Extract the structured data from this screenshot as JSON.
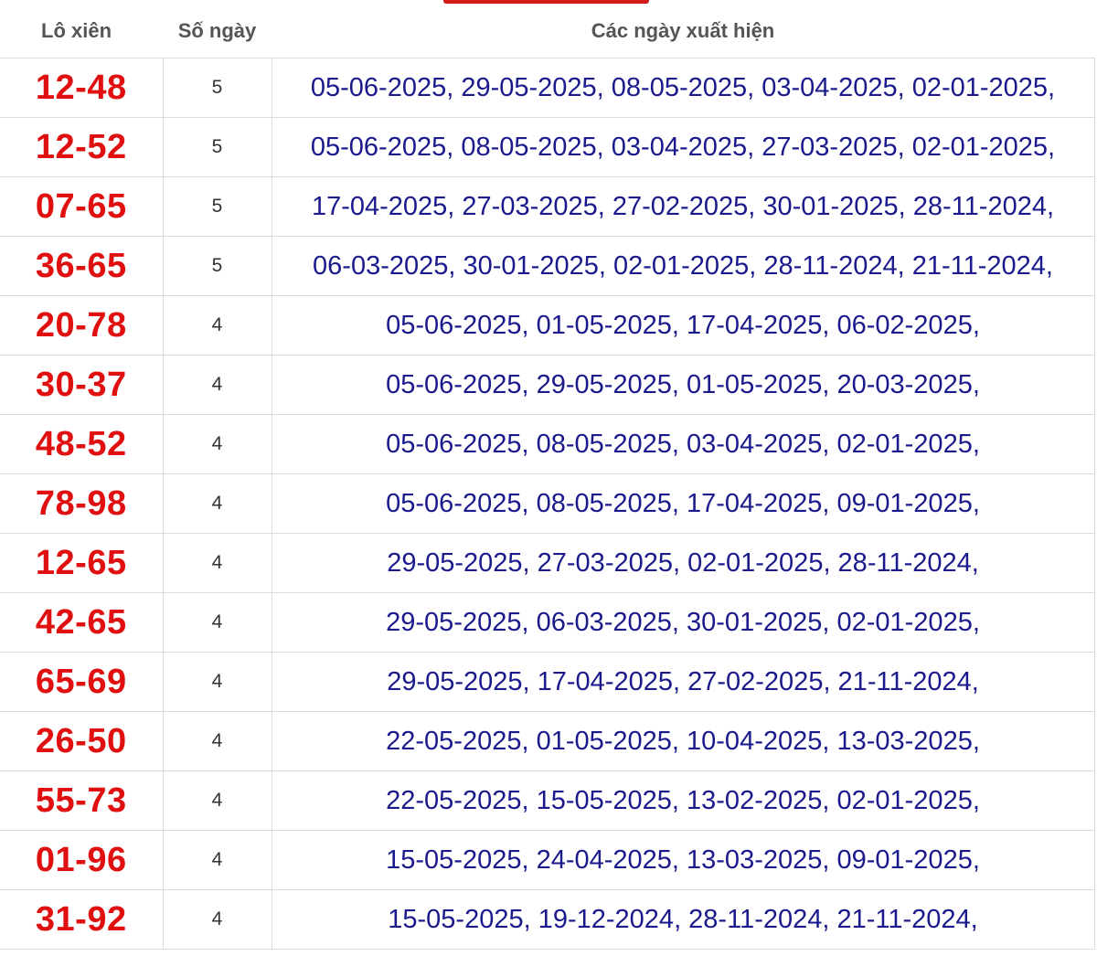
{
  "colors": {
    "accent": "#d21b1b",
    "pair_text": "#e01010",
    "date_text": "#1a1a8c",
    "header_text": "#555555",
    "border": "#dcdcdc"
  },
  "table": {
    "headers": [
      "Lô xiên",
      "Số ngày",
      "Các ngày xuất hiện"
    ],
    "rows": [
      {
        "pair": "12-48",
        "count": "5",
        "dates": "05-06-2025, 29-05-2025, 08-05-2025, 03-04-2025, 02-01-2025,"
      },
      {
        "pair": "12-52",
        "count": "5",
        "dates": "05-06-2025, 08-05-2025, 03-04-2025, 27-03-2025, 02-01-2025,"
      },
      {
        "pair": "07-65",
        "count": "5",
        "dates": "17-04-2025, 27-03-2025, 27-02-2025, 30-01-2025, 28-11-2024,"
      },
      {
        "pair": "36-65",
        "count": "5",
        "dates": "06-03-2025, 30-01-2025, 02-01-2025, 28-11-2024, 21-11-2024,"
      },
      {
        "pair": "20-78",
        "count": "4",
        "dates": "05-06-2025, 01-05-2025, 17-04-2025, 06-02-2025,"
      },
      {
        "pair": "30-37",
        "count": "4",
        "dates": "05-06-2025, 29-05-2025, 01-05-2025, 20-03-2025,"
      },
      {
        "pair": "48-52",
        "count": "4",
        "dates": "05-06-2025, 08-05-2025, 03-04-2025, 02-01-2025,"
      },
      {
        "pair": "78-98",
        "count": "4",
        "dates": "05-06-2025, 08-05-2025, 17-04-2025, 09-01-2025,"
      },
      {
        "pair": "12-65",
        "count": "4",
        "dates": "29-05-2025, 27-03-2025, 02-01-2025, 28-11-2024,"
      },
      {
        "pair": "42-65",
        "count": "4",
        "dates": "29-05-2025, 06-03-2025, 30-01-2025, 02-01-2025,"
      },
      {
        "pair": "65-69",
        "count": "4",
        "dates": "29-05-2025, 17-04-2025, 27-02-2025, 21-11-2024,"
      },
      {
        "pair": "26-50",
        "count": "4",
        "dates": "22-05-2025, 01-05-2025, 10-04-2025, 13-03-2025,"
      },
      {
        "pair": "55-73",
        "count": "4",
        "dates": "22-05-2025, 15-05-2025, 13-02-2025, 02-01-2025,"
      },
      {
        "pair": "01-96",
        "count": "4",
        "dates": "15-05-2025, 24-04-2025, 13-03-2025, 09-01-2025,"
      },
      {
        "pair": "31-92",
        "count": "4",
        "dates": "15-05-2025, 19-12-2024, 28-11-2024, 21-11-2024,"
      }
    ]
  }
}
